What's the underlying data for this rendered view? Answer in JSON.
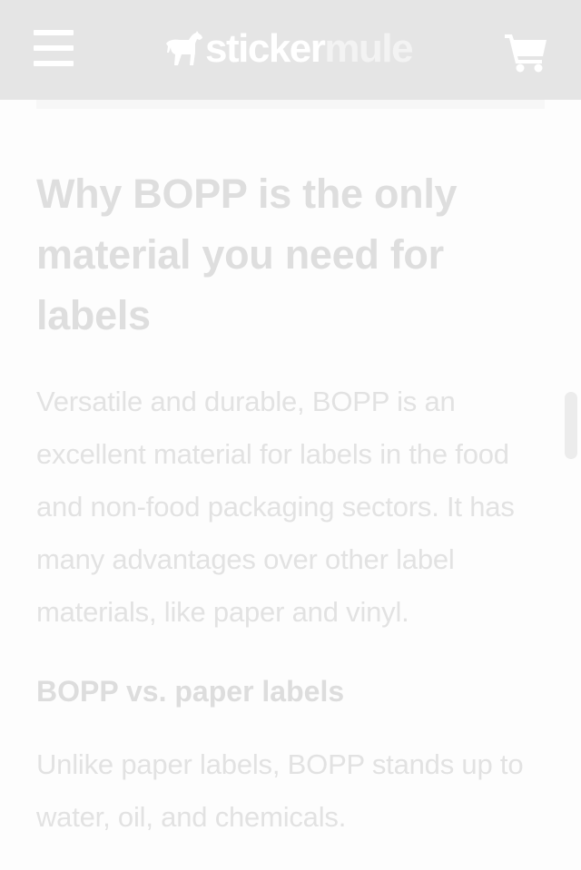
{
  "header": {
    "menu_icon": "hamburger-menu-icon",
    "logo": {
      "part1": "sticker",
      "part2": "mule",
      "icon": "mule-logo-icon"
    },
    "cart_icon": "shopping-cart-icon",
    "background": "#e5e5e5"
  },
  "article": {
    "heading": "Why BOPP is the only material you need for labels",
    "intro": "Versatile and durable, BOPP is an excellent material for labels in the food and non-food packaging sectors. It has many advantages over other label materials, like paper and vinyl.",
    "subheading": "BOPP vs. paper labels",
    "paragraph2": "Unlike paper labels, BOPP stands up to water, oil, and chemicals."
  }
}
